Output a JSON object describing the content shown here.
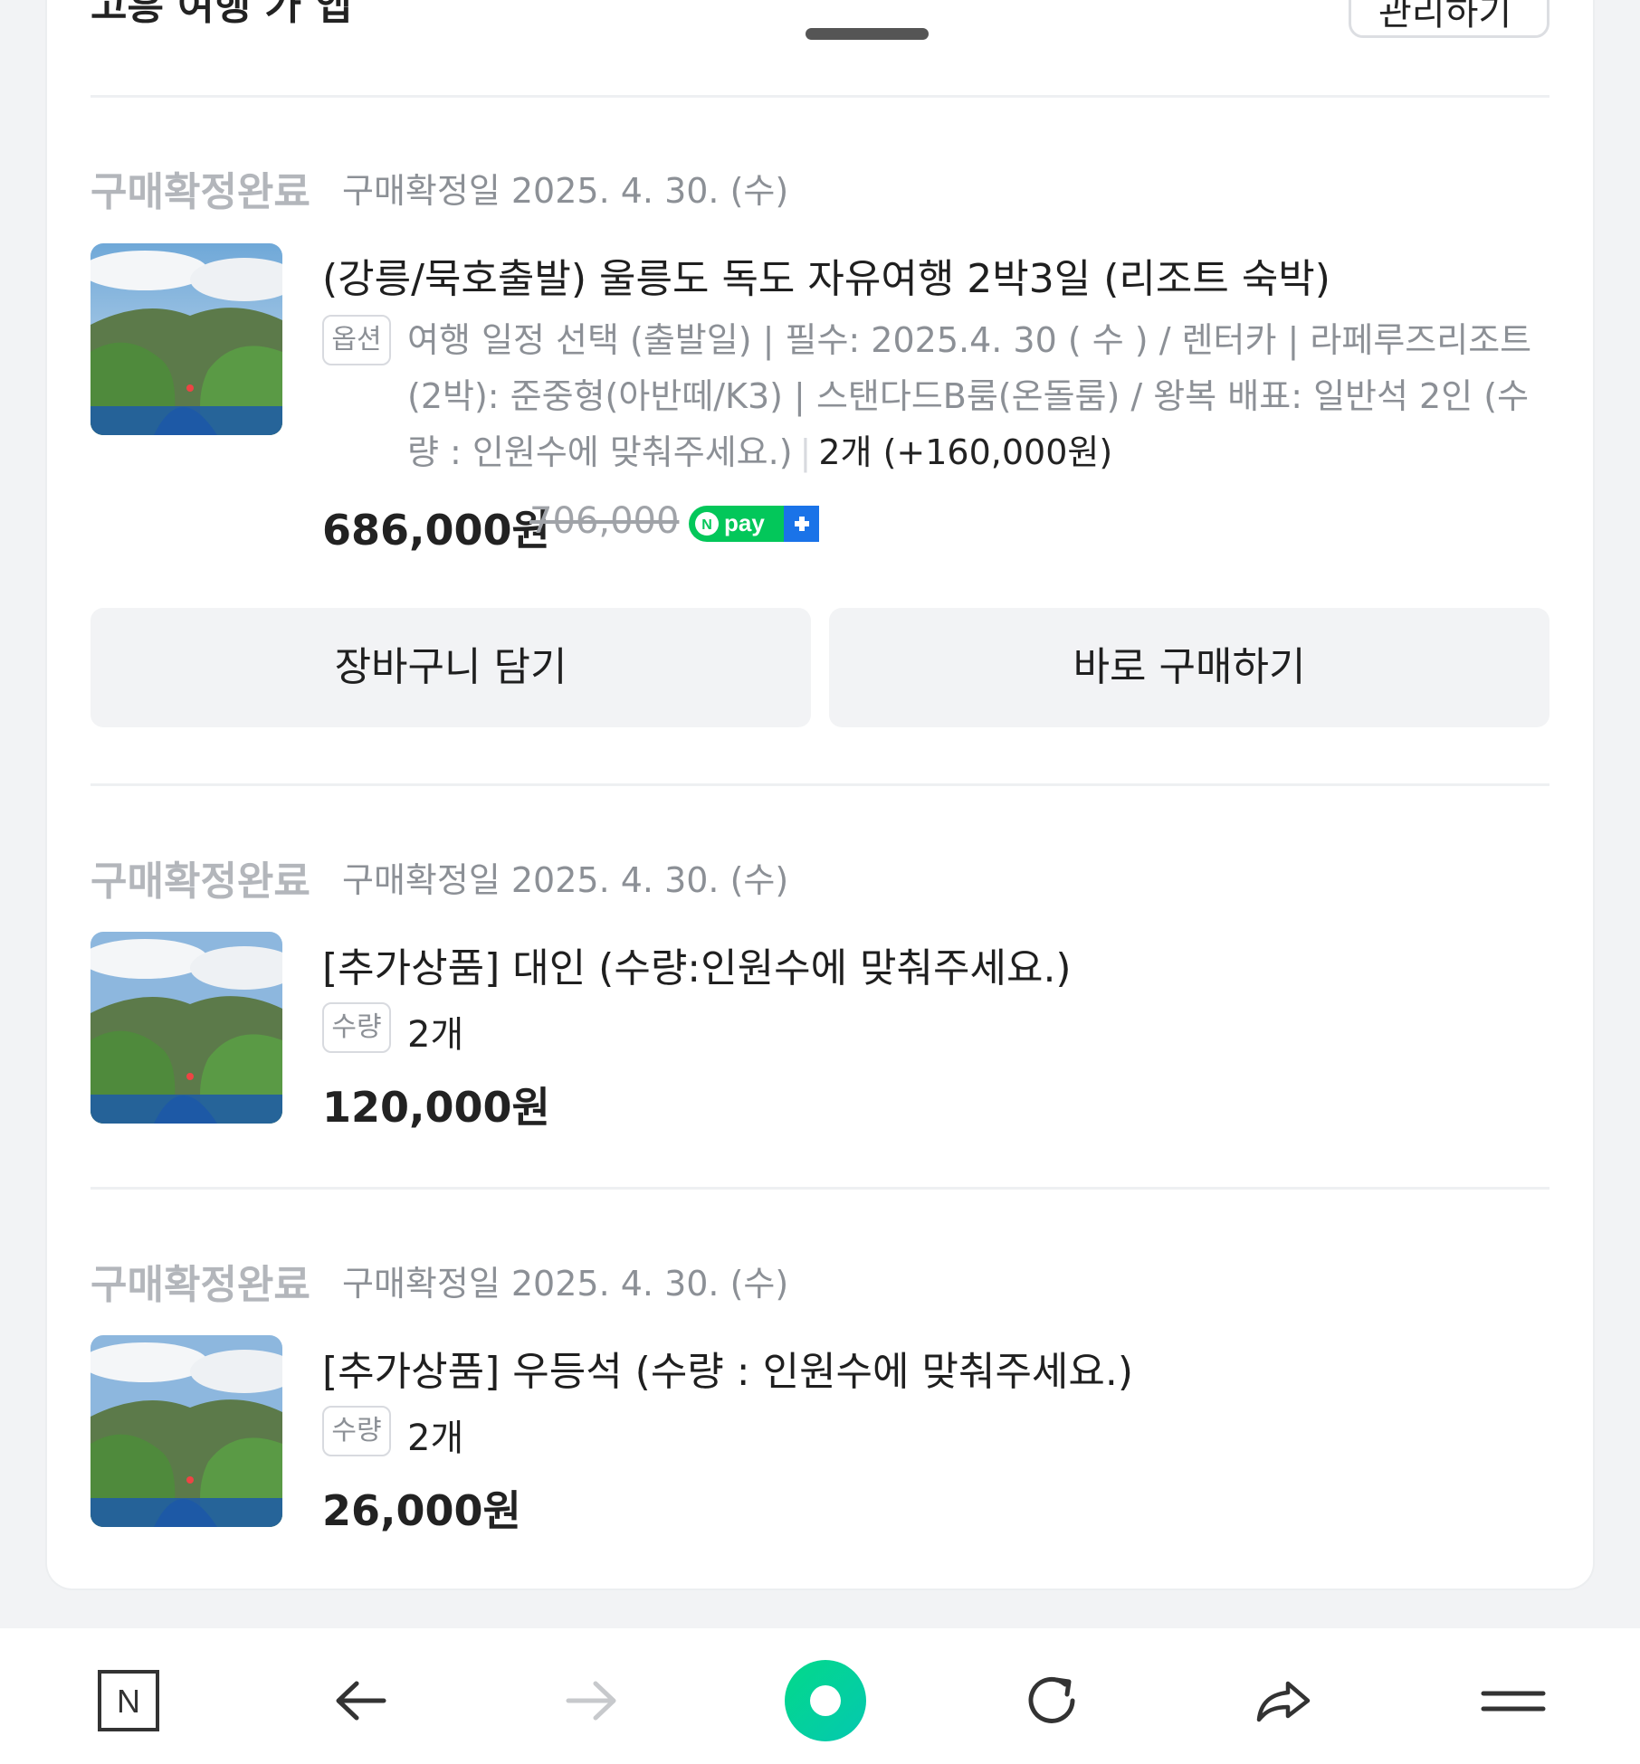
{
  "header": {
    "title": "고흥 여행 가 앱",
    "action_label": "관리하기"
  },
  "orders": [
    {
      "status": "구매확정완료",
      "confirm_date": "구매확정일 2025. 4. 30. (수)",
      "image_alt": "울릉도 전경",
      "title": "(강릉/묵호출발) 울릉도 독도 자유여행 2박3일 (리조트 숙박)",
      "option_tag": "옵션",
      "option_text": "여행 일정 선택 (출발일) | 필수: 2025.4. 30 ( 수 ) / 렌터카 | 라페루즈리조트 (2박): 준중형(아반떼/K3) | 스탠다드B룸(온돌룸) / 왕복 배표: 일반석 2인 (수량 : 인원수에 맞춰주세요.)",
      "quantity": "2개 (+160,000원)",
      "price": "686,000원",
      "original_price": "706,000",
      "pay_badge": "pay"
    },
    {
      "status": "구매확정완료",
      "confirm_date": "구매확정일 2025. 4. 30. (수)",
      "image_alt": "울릉도 전경",
      "title": "[추가상품] 대인 (수량:인원수에 맞춰주세요.)",
      "option_tag": "수량",
      "quantity": "2개",
      "price": "120,000원"
    },
    {
      "status": "구매확정완료",
      "confirm_date": "구매확정일 2025. 4. 30. (수)",
      "image_alt": "울릉도 전경",
      "title": "[추가상품] 우등석 (수량 : 인원수에 맞춰주세요.)",
      "option_tag": "수량",
      "quantity": "2개",
      "price": "26,000원"
    }
  ],
  "actions": {
    "cart_label": "장바구니 담기",
    "buy_label": "바로 구매하기"
  },
  "bottom_nav": {
    "items": [
      "naver-home-icon",
      "back-arrow-icon",
      "forward-arrow-icon",
      "green-dot-icon",
      "refresh-icon",
      "share-icon",
      "menu-icon"
    ]
  },
  "colors": {
    "npay_green": "#03c75a",
    "npay_blue": "#1a73e8",
    "status_gray": "#b3b6bb"
  }
}
